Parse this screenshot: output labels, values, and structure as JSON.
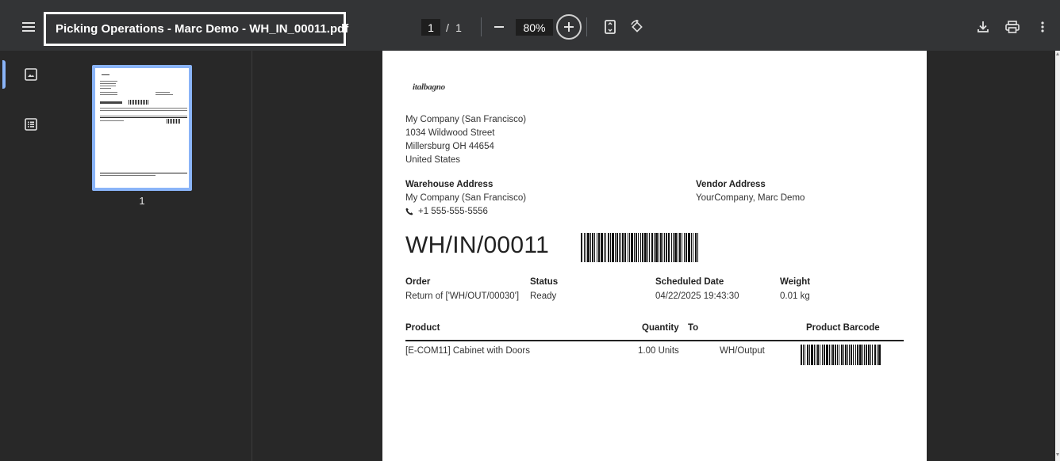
{
  "viewer": {
    "title": "Picking Operations - Marc Demo - WH_IN_00011.pdf",
    "current_page": "1",
    "page_separator": "/",
    "total_pages": "1",
    "zoom": "80%",
    "thumbnail_label": "1",
    "accent_color": "#8ab4f8"
  },
  "icons": {
    "menu": "menu-icon",
    "zoom_out": "minus-icon",
    "zoom_in": "plus-circle-icon",
    "fit_page": "fit-page-icon",
    "rotate": "rotate-icon",
    "download": "download-icon",
    "print": "print-icon",
    "more": "more-vert-icon",
    "thumbnails": "image-icon",
    "outline": "list-icon",
    "phone": "phone-icon"
  },
  "document": {
    "logo_text": "italbagno",
    "company": {
      "lines": [
        "My Company (San Francisco)",
        "1034 Wildwood Street",
        "Millersburg OH 44654",
        "United States"
      ]
    },
    "warehouse": {
      "label": "Warehouse Address",
      "name": "My Company (San Francisco)",
      "phone": "+1 555-555-5556"
    },
    "vendor": {
      "label": "Vendor Address",
      "name": "YourCompany, Marc Demo"
    },
    "reference": "WH/IN/00011",
    "info": {
      "order_label": "Order",
      "order_value": "Return of ['WH/OUT/00030']",
      "status_label": "Status",
      "status_value": "Ready",
      "scheduled_label": "Scheduled Date",
      "scheduled_value": "04/22/2025 19:43:30",
      "weight_label": "Weight",
      "weight_value": "0.01 kg"
    },
    "table": {
      "headers": [
        "Product",
        "Quantity",
        "To",
        "Product Barcode"
      ],
      "rows": [
        {
          "product": "[E-COM11] Cabinet with Doors",
          "quantity": "1.00 Units",
          "to": "WH/Output"
        }
      ]
    }
  }
}
